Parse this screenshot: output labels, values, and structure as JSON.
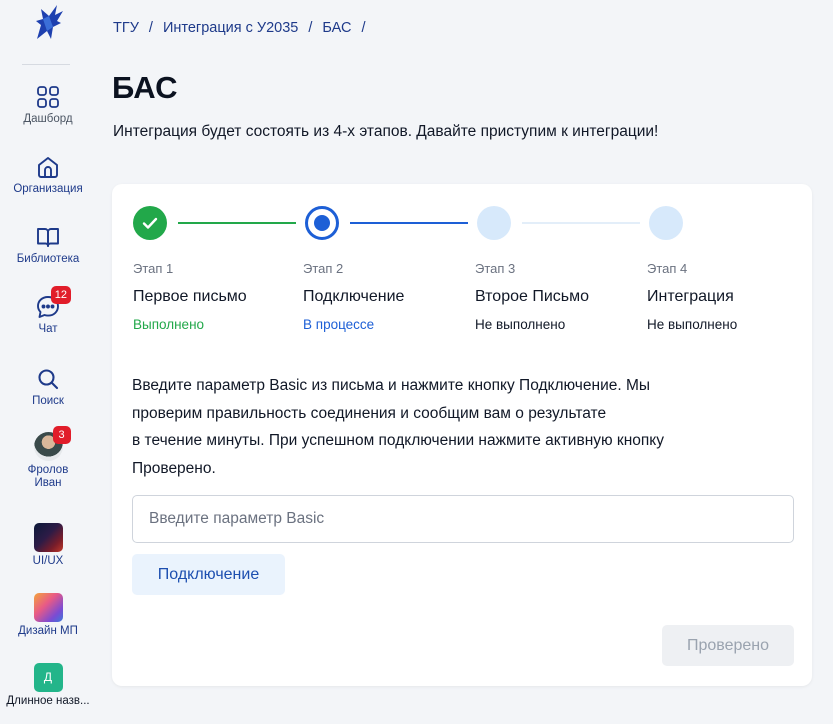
{
  "sidebar": {
    "items": [
      {
        "label": "Дашборд",
        "icon": "dashboard-icon"
      },
      {
        "label": "Организация",
        "icon": "home-icon"
      },
      {
        "label": "Библиотека",
        "icon": "book-icon"
      },
      {
        "label": "Чат",
        "icon": "chat-icon",
        "badge": "12"
      },
      {
        "label": "Поиск",
        "icon": "search-icon"
      },
      {
        "label": "Фролов Иван",
        "label_line1": "Фролов",
        "label_line2": "Иван",
        "badge": "3"
      },
      {
        "label": "UI/UX"
      },
      {
        "label": "Дизайн МП"
      },
      {
        "label": "Длинное назв...",
        "initial": "Д"
      }
    ]
  },
  "breadcrumb": [
    "ТГУ",
    "Интеграция с У2035",
    "БАС"
  ],
  "breadcrumb_sep": "/",
  "page": {
    "title": "БАС",
    "intro": "Интеграция будет состоять из  4-х этапов. Давайте приступим к интеграции!"
  },
  "stepper": {
    "steps": [
      {
        "caption": "Этап 1",
        "name": "Первое письмо",
        "status": "Выполнено",
        "state": "done"
      },
      {
        "caption": "Этап 2",
        "name": "Подключение",
        "status": "В процессе",
        "state": "active"
      },
      {
        "caption": "Этап 3",
        "name": "Второе Письмо",
        "status": "Не выполнено",
        "state": "todo"
      },
      {
        "caption": "Этап 4",
        "name": "Интеграция",
        "status": "Не выполнено",
        "state": "todo"
      }
    ]
  },
  "form": {
    "instructions_1": "Введите параметр Basic из письма и нажмите кнопку Подключение. Мы",
    "instructions_2": "проверим правильность соединения и сообщим вам о результате",
    "instructions_3": "в течение минуты. При успешном подключении нажмите активную кнопку",
    "instructions_4": "Проверено.",
    "input_placeholder": "Введите параметр Basic",
    "input_value": "",
    "connect_label": "Подключение",
    "verified_label": "Проверено"
  },
  "colors": {
    "done": "#22a84a",
    "active": "#1d5fd6",
    "todo": "#d7e9fb",
    "badge": "#e11d2a"
  }
}
